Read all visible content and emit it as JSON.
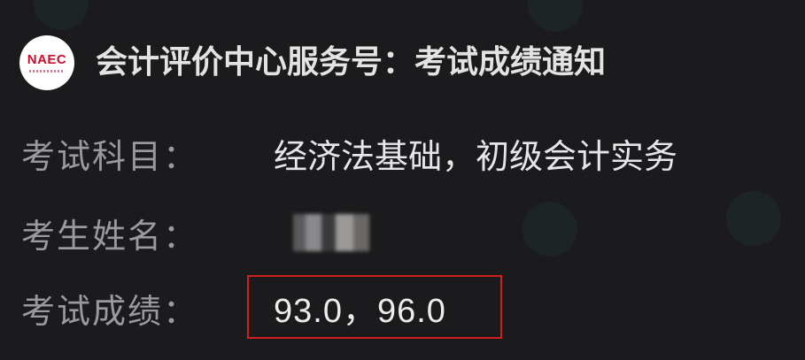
{
  "header": {
    "logo_text": "NAEC",
    "title": "会计评价中心服务号：考试成绩通知"
  },
  "fields": {
    "subject": {
      "label": "考试科目：",
      "value": "经济法基础，初级会计实务"
    },
    "name": {
      "label": "考生姓名："
    },
    "score": {
      "label": "考试成绩：",
      "value": "93.0，96.0"
    }
  },
  "colors": {
    "background": "#1b1a1c",
    "highlight_border": "#d01f1f",
    "logo_accent": "#c8102e"
  }
}
